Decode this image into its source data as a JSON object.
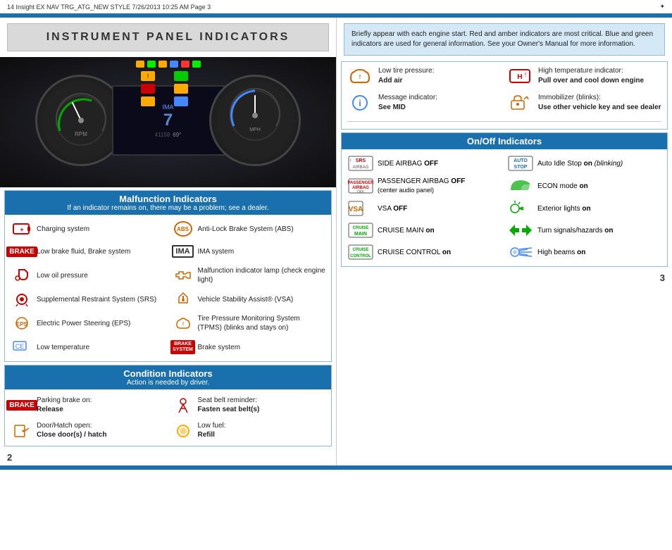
{
  "meta": {
    "file_info": "14 Insight EX NAV TRG_ATG_NEW STYLE  7/26/2013  10:25 AM  Page 3"
  },
  "page_title": "INSTRUMENT PANEL INDICATORS",
  "info_box_text": "Briefly appear with each engine start. Red and amber indicators are most critical. Blue and green indicators are used for general information. See your Owner's Manual for more information.",
  "malfunction": {
    "header": "Malfunction Indicators",
    "subheader": "If an indicator remains on, there may be a problem; see a dealer.",
    "items_left": [
      {
        "label": "Charging system"
      },
      {
        "label": "Low brake fluid, Brake system"
      },
      {
        "label": "Low oil pressure"
      },
      {
        "label": "Supplemental Restraint System (SRS)"
      },
      {
        "label": "Electric Power Steering (EPS)"
      },
      {
        "label": "Low temperature"
      }
    ],
    "items_right": [
      {
        "label": "Anti-Lock Brake System (ABS)"
      },
      {
        "label": "IMA system"
      },
      {
        "label": "Malfunction indicator lamp (check engine light)"
      },
      {
        "label": "Vehicle Stability Assist® (VSA)"
      },
      {
        "label": "Tire Pressure Monitoring System (TPMS) (blinks and stays on)"
      },
      {
        "label": "Brake system"
      }
    ]
  },
  "condition": {
    "header": "Condition Indicators",
    "subheader": "Action is needed by driver.",
    "items_left": [
      {
        "label_normal": "Parking brake on:",
        "label_bold": "Release"
      },
      {
        "label_normal": "Door/Hatch open:",
        "label_bold": "Close door(s) / hatch"
      }
    ],
    "items_right": [
      {
        "label_normal": "Seat belt reminder:",
        "label_bold": "Fasten seat belt(s)"
      },
      {
        "label_normal": "Low fuel:",
        "label_bold": "Refill"
      }
    ]
  },
  "right_info": {
    "row1_left_label": "Low tire pressure:",
    "row1_left_bold": "Add air",
    "row1_right_label": "High temperature indicator:",
    "row1_right_bold": "Pull over and cool down engine",
    "row2_left_label": "Message indicator:",
    "row2_left_bold": "See MID",
    "row2_right_label": "Immobilizer (blinks):",
    "row2_right_bold": "Use other vehicle key and see dealer"
  },
  "onoff": {
    "header": "On/Off Indicators",
    "items_left": [
      {
        "label_normal": "SIDE AIRBAG ",
        "label_bold": "OFF"
      },
      {
        "label_normal": "PASSENGER AIRBAG ",
        "label_bold": "OFF",
        "sub": "(center audio panel)"
      },
      {
        "label_normal": "VSA ",
        "label_bold": "OFF"
      },
      {
        "label_normal": "CRUISE MAIN ",
        "label_bold": "on"
      },
      {
        "label_normal": "CRUISE CONTROL ",
        "label_bold": "on"
      }
    ],
    "items_right": [
      {
        "label_normal": "Auto Idle Stop ",
        "label_bold": "on",
        "sub": "(blinking)"
      },
      {
        "label_normal": "ECON mode ",
        "label_bold": "on"
      },
      {
        "label_normal": "Exterior lights ",
        "label_bold": "on"
      },
      {
        "label_normal": "Turn signals/hazards ",
        "label_bold": "on"
      },
      {
        "label_normal": "High beams ",
        "label_bold": "on"
      }
    ]
  },
  "pages": {
    "left": "2",
    "right": "3"
  }
}
